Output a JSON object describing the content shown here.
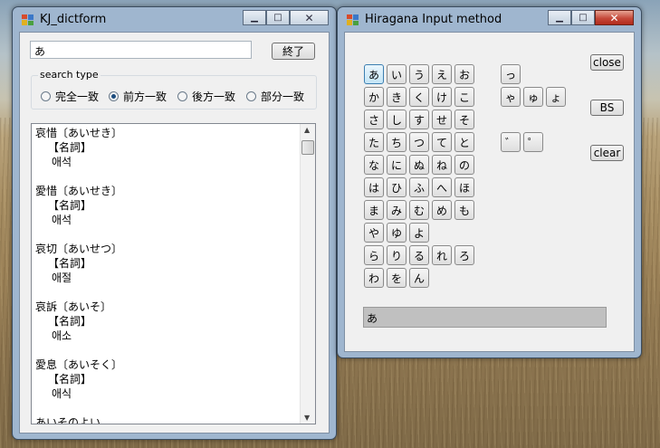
{
  "windows": {
    "dict": {
      "title": "KJ_dictform",
      "search_value": "あ",
      "end_button": "終了",
      "search_type_label": "search type",
      "radio_options": [
        {
          "label": "完全一致",
          "checked": false
        },
        {
          "label": "前方一致",
          "checked": true
        },
        {
          "label": "後方一致",
          "checked": false
        },
        {
          "label": "部分一致",
          "checked": false
        }
      ],
      "results": [
        {
          "headword": "哀惜〔あいせき〕",
          "pos": "【名詞】",
          "korean": "애석"
        },
        {
          "headword": "愛惜〔あいせき〕",
          "pos": "【名詞】",
          "korean": "애석"
        },
        {
          "headword": "哀切〔あいせつ〕",
          "pos": "【名詞】",
          "korean": "애절"
        },
        {
          "headword": "哀訴〔あいそ〕",
          "pos": "【名詞】",
          "korean": "애소"
        },
        {
          "headword": "愛息〔あいそく〕",
          "pos": "【名詞】",
          "korean": "애식"
        }
      ],
      "partial_entry": "あいそのよい"
    },
    "hira": {
      "title": "Hiragana Input method",
      "kana_rows": [
        [
          "あ",
          "い",
          "う",
          "え",
          "お"
        ],
        [
          "か",
          "き",
          "く",
          "け",
          "こ"
        ],
        [
          "さ",
          "し",
          "す",
          "せ",
          "そ"
        ],
        [
          "た",
          "ち",
          "つ",
          "て",
          "と"
        ],
        [
          "な",
          "に",
          "ぬ",
          "ね",
          "の"
        ],
        [
          "は",
          "ひ",
          "ふ",
          "へ",
          "ほ"
        ],
        [
          "ま",
          "み",
          "む",
          "め",
          "も"
        ],
        [
          "や",
          "ゆ",
          "よ"
        ],
        [
          "ら",
          "り",
          "る",
          "れ",
          "ろ"
        ],
        [
          "わ",
          "を",
          "ん"
        ]
      ],
      "small_kana": {
        "tsu": "っ",
        "ya": "ゃ",
        "yu": "ゅ",
        "yo": "ょ",
        "dakuten": "゛",
        "handakuten": "゜"
      },
      "close_button": "close",
      "bs_button": "BS",
      "clear_button": "clear",
      "output_value": "あ"
    }
  },
  "icons": {
    "app_icon": "app-window-icon",
    "minimize": "minimize-icon",
    "maximize": "maximize-icon",
    "close": "close-icon"
  },
  "colors": {
    "titlebar": "#9fb6cf",
    "close_red": "#c5493a",
    "selected_key": "#c4e5f6",
    "output_box": "#c0c0c0"
  }
}
